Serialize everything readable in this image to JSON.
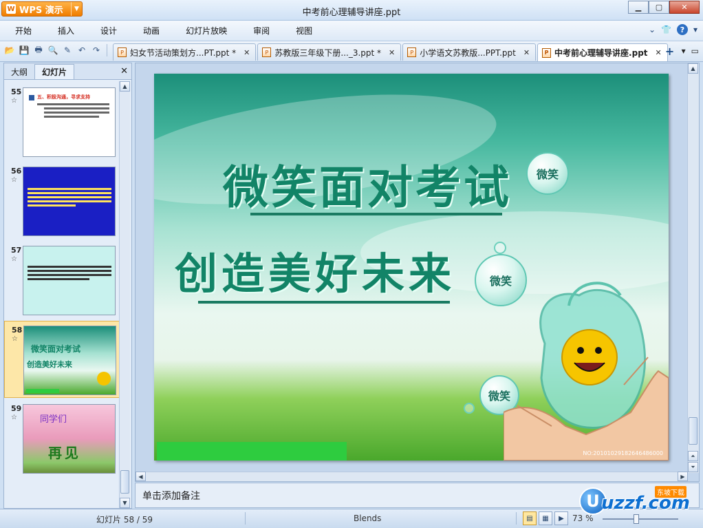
{
  "app": {
    "menu_button": "WPS 演示",
    "window_title": "中考前心理辅导讲座.ppt"
  },
  "menu": {
    "items": [
      "开始",
      "插入",
      "设计",
      "动画",
      "幻灯片放映",
      "审阅",
      "视图"
    ]
  },
  "tabs": [
    {
      "label": "妇女节活动策划方...PT.ppt *",
      "active": false
    },
    {
      "label": "苏教版三年级下册..._3.ppt *",
      "active": false
    },
    {
      "label": "小学语文苏教版...PPT.ppt",
      "active": false
    },
    {
      "label": "中考前心理辅导讲座.ppt",
      "active": true
    }
  ],
  "side_panel": {
    "tab_outline": "大纲",
    "tab_slides": "幻灯片",
    "slides": [
      {
        "num": "55",
        "selected": false,
        "heading": "五、积极沟通，寻求支持"
      },
      {
        "num": "56",
        "selected": false
      },
      {
        "num": "57",
        "selected": false
      },
      {
        "num": "58",
        "selected": true,
        "title1": "微笑面对考试",
        "title2": "创造美好未来"
      },
      {
        "num": "59",
        "selected": false,
        "line1": "同学们",
        "line2": "再见"
      }
    ]
  },
  "slide": {
    "title_line1": "微笑面对考试",
    "title_line2": "创造美好未来",
    "bubble_text": "微笑",
    "serial": "NO:20101029182646486000",
    "accent_color": "#128467",
    "bar_color": "#2ecc3f"
  },
  "notes": {
    "placeholder": "单击添加备注"
  },
  "status": {
    "slide_counter": "幻灯片 58 / 59",
    "theme": "Blends",
    "zoom": "73 %"
  },
  "watermark": {
    "brand": "uzzf.com",
    "tag": "东坡下载"
  }
}
